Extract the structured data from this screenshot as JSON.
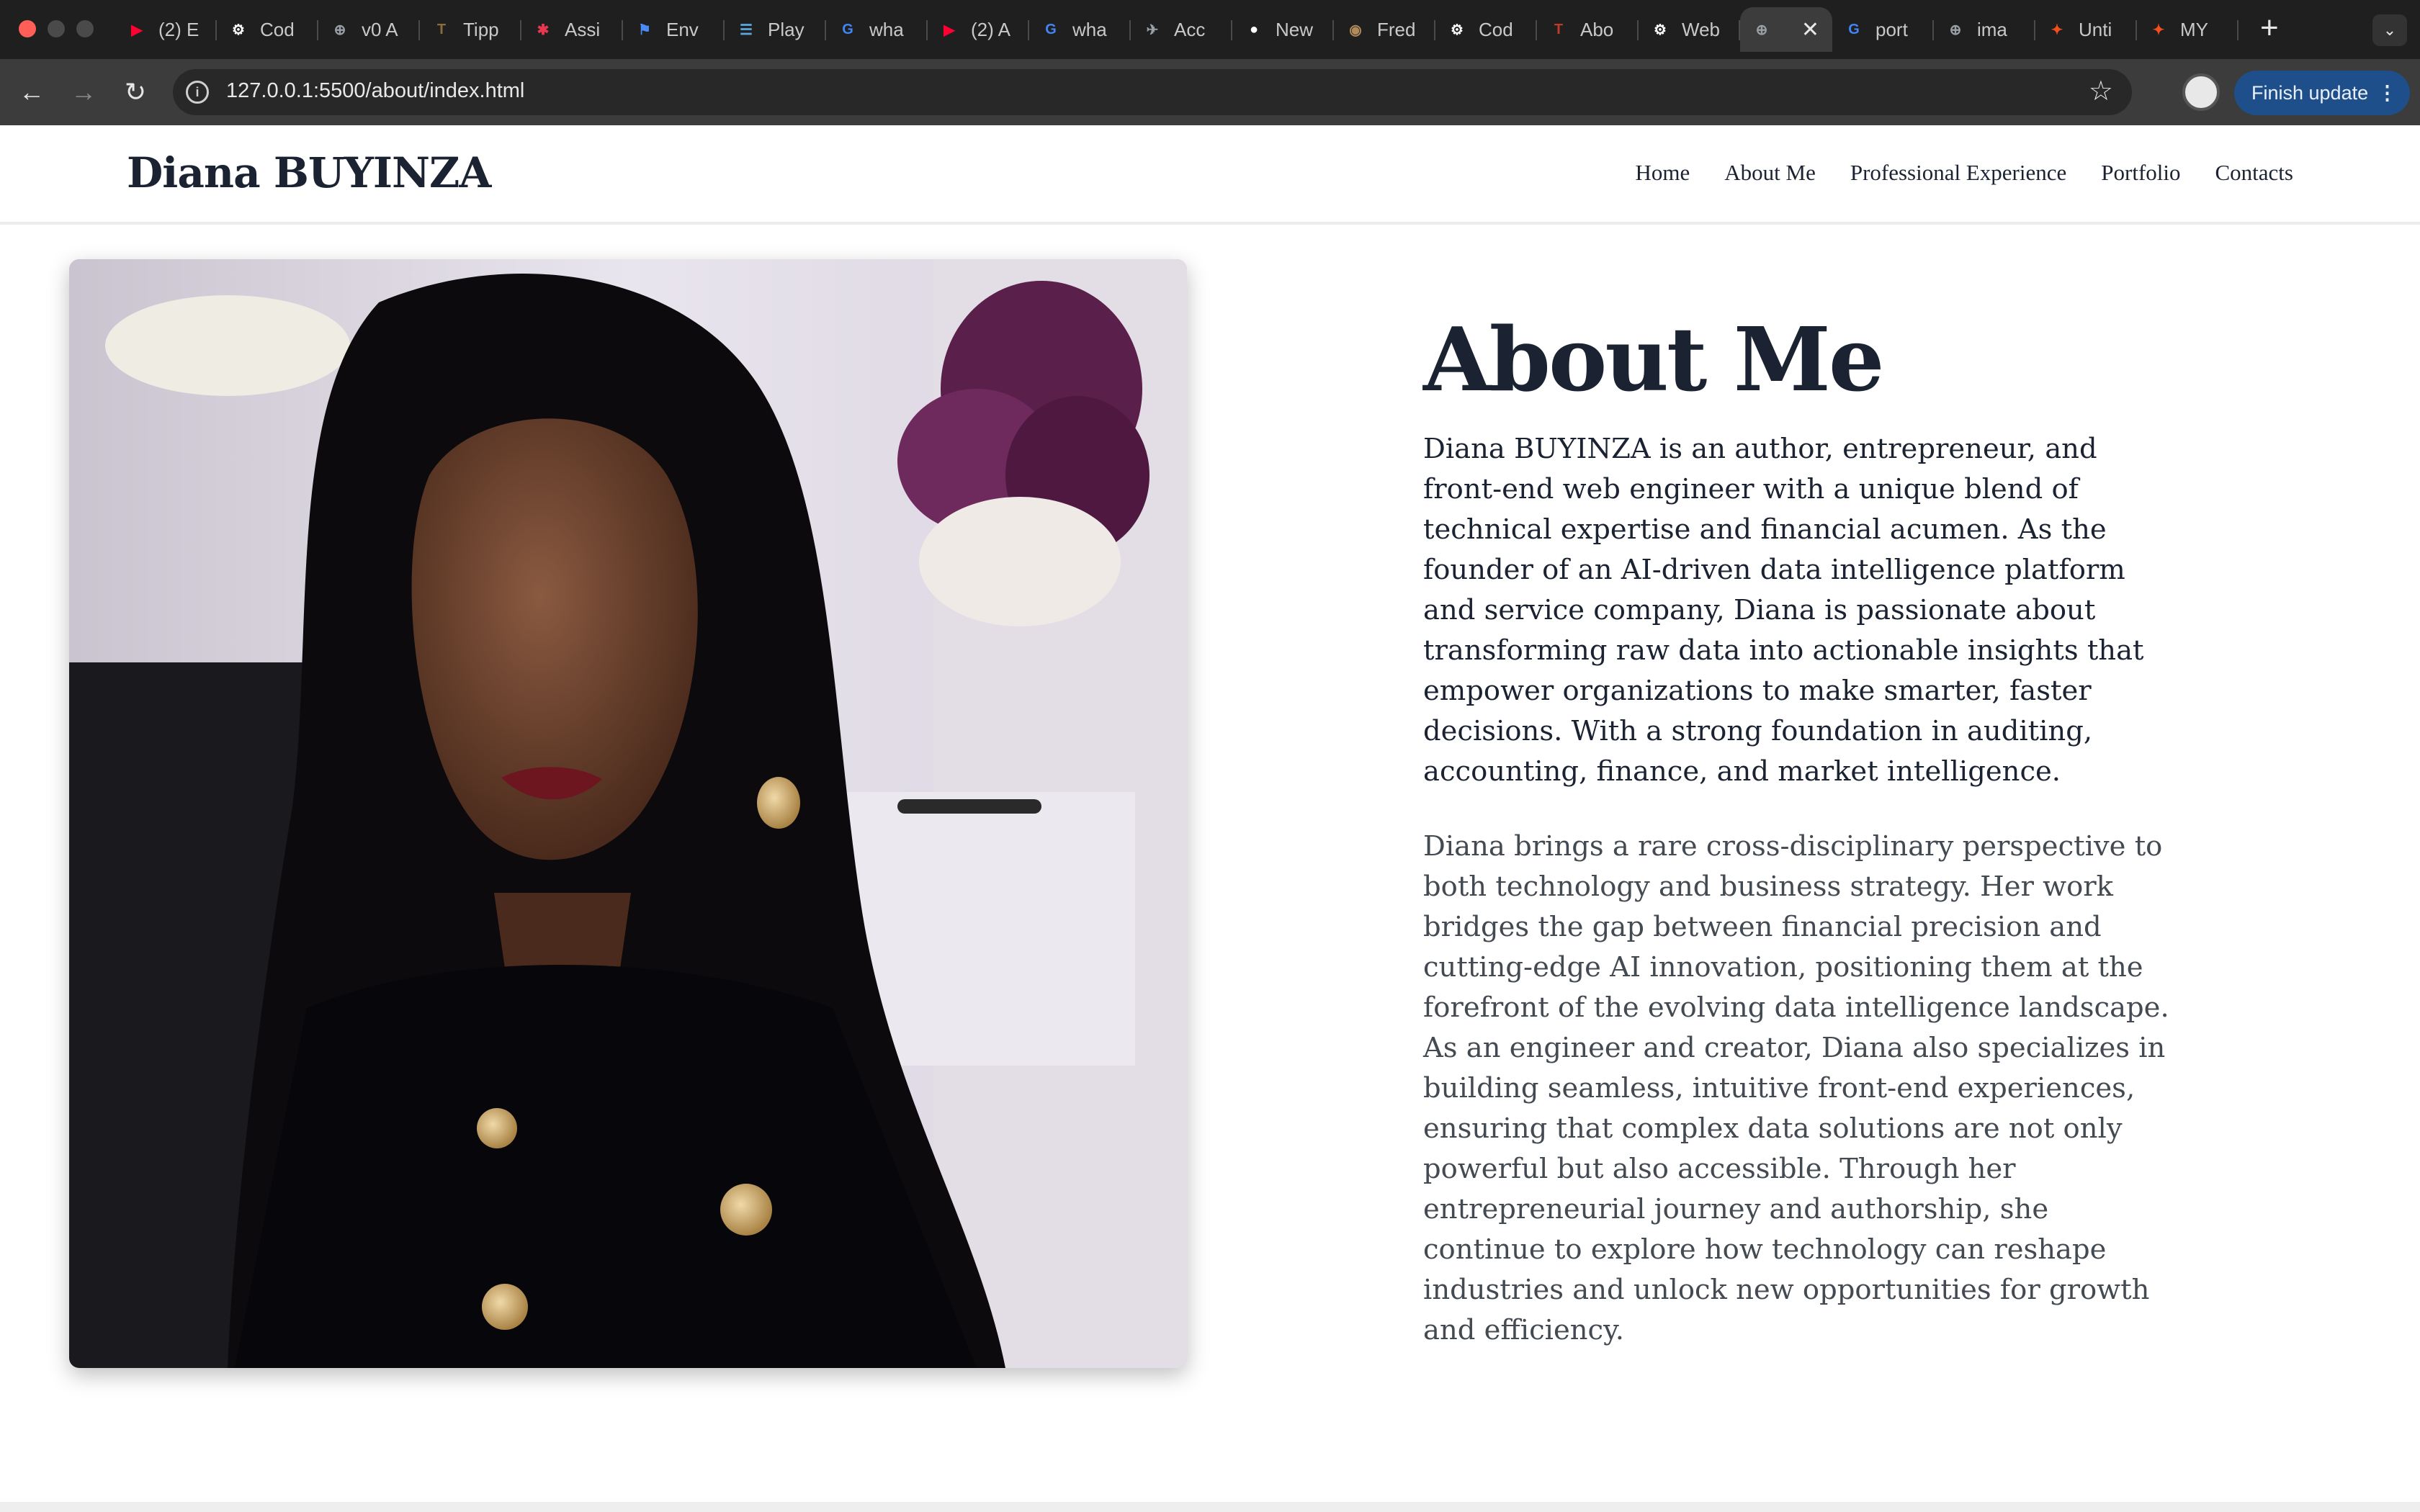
{
  "colors": {
    "tab_bar_bg": "#1f1f1f",
    "address_bar_bg": "#3c3c3c",
    "update_button_bg": "#1e4f8a",
    "heading_text": "#1b2332",
    "body_text": "#444a52"
  },
  "browser": {
    "tabs": [
      {
        "label": "(2) E",
        "icon": "youtube-icon",
        "color": "#ff0033",
        "glyph": "▶"
      },
      {
        "label": "Cod",
        "icon": "openai-icon",
        "color": "#ffffff",
        "glyph": "⚙"
      },
      {
        "label": "v0 A",
        "icon": "globe-icon",
        "color": "#9aa0a6",
        "glyph": "⊕"
      },
      {
        "label": "Tipp",
        "icon": "tipp-icon",
        "color": "#8a6d3b",
        "glyph": "T"
      },
      {
        "label": "Assi",
        "icon": "asana-icon",
        "color": "#e8384f",
        "glyph": "✱"
      },
      {
        "label": "Env",
        "icon": "flag-icon",
        "color": "#4a8bf5",
        "glyph": "⚑"
      },
      {
        "label": "Play",
        "icon": "playwright-icon",
        "color": "#5aa8e0",
        "glyph": "☰"
      },
      {
        "label": "wha",
        "icon": "google-icon",
        "color": "#4285f4",
        "glyph": "G"
      },
      {
        "label": "(2) A",
        "icon": "youtube-icon",
        "color": "#ff0033",
        "glyph": "▶"
      },
      {
        "label": "wha",
        "icon": "google-icon",
        "color": "#4285f4",
        "glyph": "G"
      },
      {
        "label": "Acc",
        "icon": "plane-icon",
        "color": "#9aa0a6",
        "glyph": "✈"
      },
      {
        "label": "New",
        "icon": "github-icon",
        "color": "#ffffff",
        "glyph": "●"
      },
      {
        "label": "Fred",
        "icon": "fred-icon",
        "color": "#b08a5a",
        "glyph": "◉"
      },
      {
        "label": "Cod",
        "icon": "openai-icon",
        "color": "#ffffff",
        "glyph": "⚙"
      },
      {
        "label": "Abo",
        "icon": "t-logo-icon",
        "color": "#c0392b",
        "glyph": "T"
      },
      {
        "label": "Web",
        "icon": "openai-icon",
        "color": "#ffffff",
        "glyph": "⚙"
      },
      {
        "label": "",
        "icon": "globe-icon",
        "color": "#9aa0a6",
        "glyph": "⊕",
        "active": true
      },
      {
        "label": "port",
        "icon": "google-icon",
        "color": "#4285f4",
        "glyph": "G"
      },
      {
        "label": "ima",
        "icon": "globe-icon",
        "color": "#9aa0a6",
        "glyph": "⊕"
      },
      {
        "label": "Unti",
        "icon": "figma-icon",
        "color": "#f24e1e",
        "glyph": "✦"
      },
      {
        "label": "MY",
        "icon": "figma-icon",
        "color": "#f24e1e",
        "glyph": "✦"
      }
    ],
    "active_tab_close": "✕",
    "new_tab": "+",
    "tab_menu": "⌄",
    "url": "127.0.0.1:5500/about/index.html",
    "update_button": "Finish update",
    "update_menu": "⋮",
    "back": "←",
    "forward": "→",
    "reload": "↻",
    "star": "☆",
    "info": "i"
  },
  "site": {
    "brand": "Diana BUYINZA",
    "nav": [
      "Home",
      "About Me",
      "Professional Experience",
      "Portfolio",
      "Contacts"
    ]
  },
  "about": {
    "title": "About Me",
    "paragraph1": "Diana BUYINZA is an author, entrepreneur, and front-end web engineer with a unique blend of technical expertise and financial acumen. As the founder of an AI-driven data intelligence platform and service company, Diana is passionate about transforming raw data into actionable insights that empower organizations to make smarter, faster decisions. With a strong foundation in auditing, accounting, finance, and market intelligence.",
    "paragraph2": "Diana brings a rare cross-disciplinary perspective to both technology and business strategy. Her work bridges the gap between financial precision and cutting-edge AI innovation, positioning them at the forefront of the evolving data intelligence landscape. As an engineer and creator, Diana also specializes in building seamless, intuitive front-end experiences, ensuring that complex data solutions are not only powerful but also accessible. Through her entrepreneurial journey and authorship, she continue to explore how technology can reshape industries and unlock new opportunities for growth and efficiency."
  }
}
